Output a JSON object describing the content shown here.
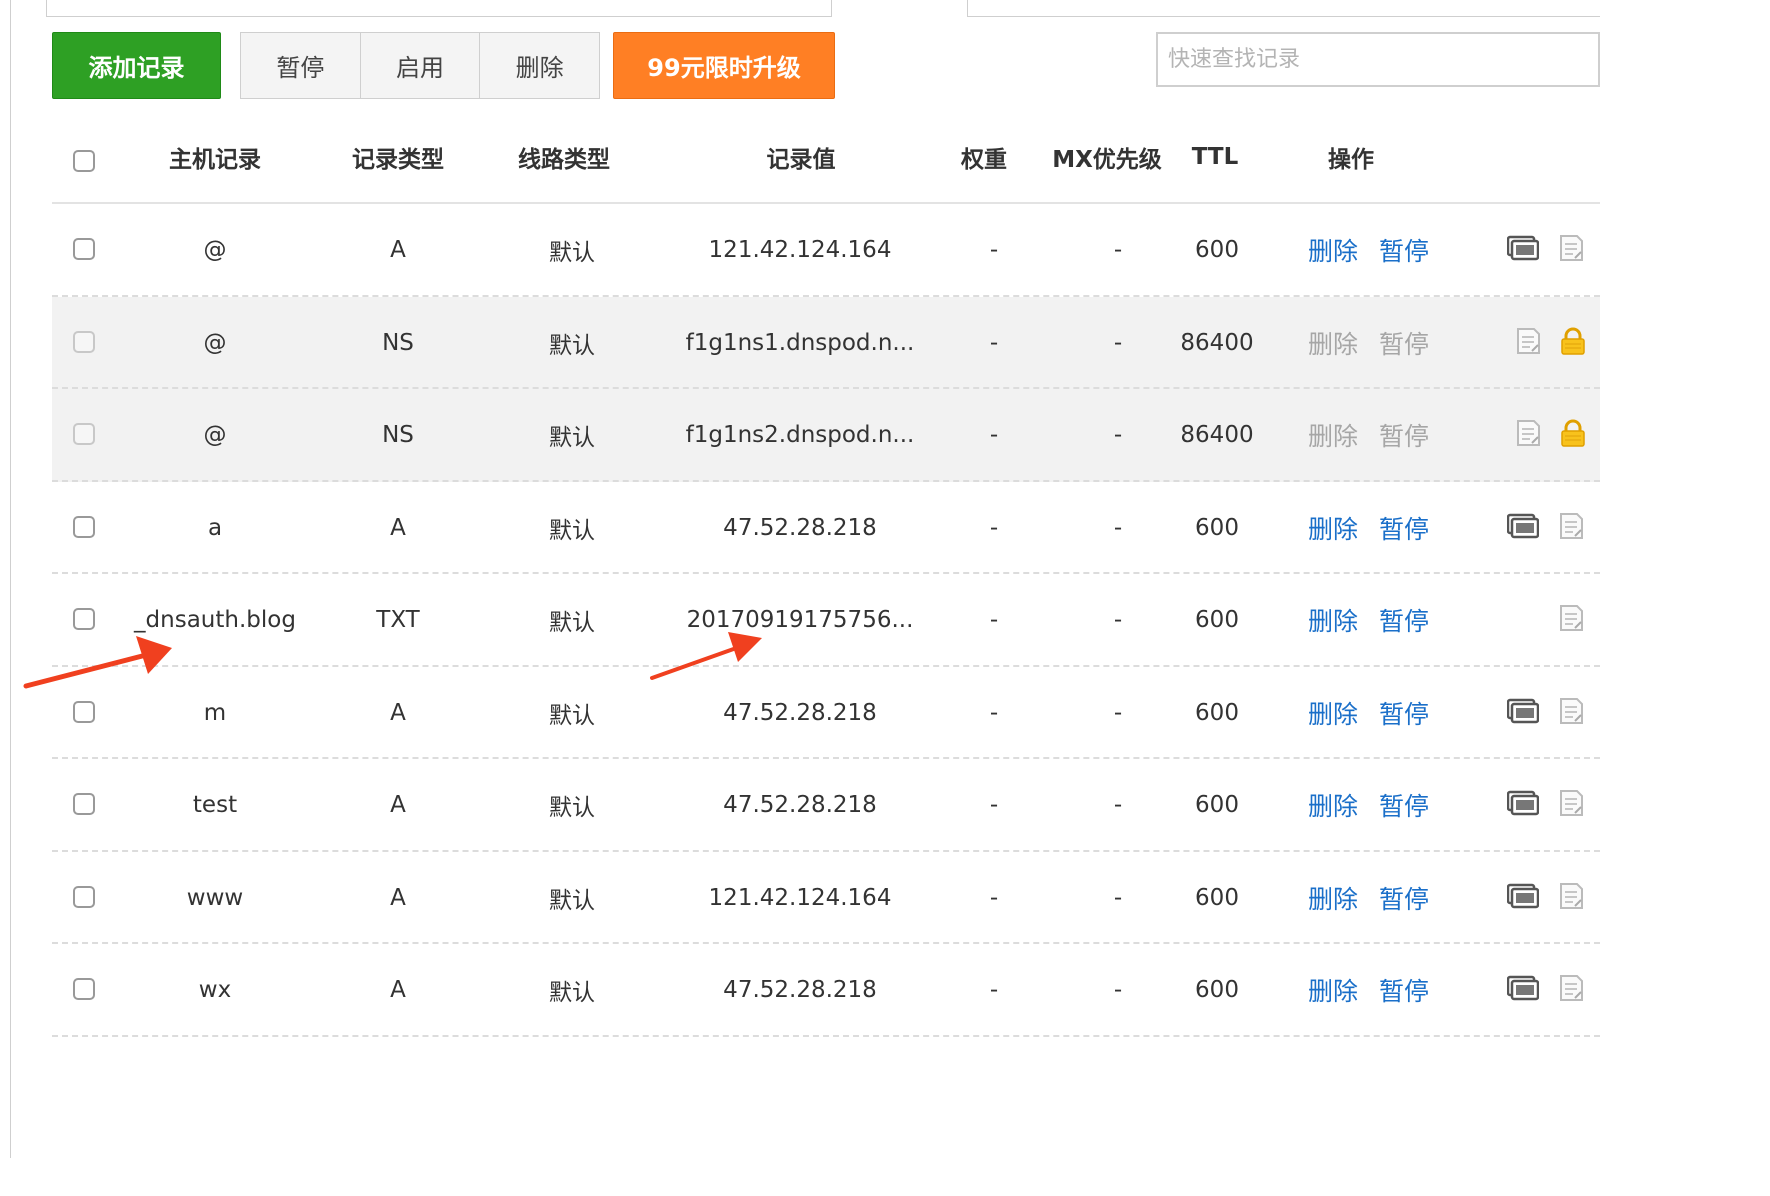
{
  "toolbar": {
    "add_label": "添加记录",
    "pause_label": "暂停",
    "enable_label": "启用",
    "delete_label": "删除",
    "upgrade_label": "99元限时升级",
    "search_placeholder": "快速查找记录"
  },
  "columns": {
    "host": "主机记录",
    "type": "记录类型",
    "line": "线路类型",
    "value": "记录值",
    "weight": "权重",
    "mx": "MX优先级",
    "ttl": "TTL",
    "ops": "操作"
  },
  "rows": [
    {
      "host": "@",
      "type": "A",
      "line": "默认",
      "value": "121.42.124.164",
      "weight": "-",
      "mx": "-",
      "ttl": "600",
      "delete": "删除",
      "pause": "暂停",
      "locked": false,
      "monitor": true
    },
    {
      "host": "@",
      "type": "NS",
      "line": "默认",
      "value": "f1g1ns1.dnspod.n...",
      "weight": "-",
      "mx": "-",
      "ttl": "86400",
      "delete": "删除",
      "pause": "暂停",
      "locked": true,
      "monitor": false
    },
    {
      "host": "@",
      "type": "NS",
      "line": "默认",
      "value": "f1g1ns2.dnspod.n...",
      "weight": "-",
      "mx": "-",
      "ttl": "86400",
      "delete": "删除",
      "pause": "暂停",
      "locked": true,
      "monitor": false
    },
    {
      "host": "a",
      "type": "A",
      "line": "默认",
      "value": "47.52.28.218",
      "weight": "-",
      "mx": "-",
      "ttl": "600",
      "delete": "删除",
      "pause": "暂停",
      "locked": false,
      "monitor": true
    },
    {
      "host": "_dnsauth.blog",
      "type": "TXT",
      "line": "默认",
      "value": "20170919175756...",
      "weight": "-",
      "mx": "-",
      "ttl": "600",
      "delete": "删除",
      "pause": "暂停",
      "locked": false,
      "monitor": false
    },
    {
      "host": "m",
      "type": "A",
      "line": "默认",
      "value": "47.52.28.218",
      "weight": "-",
      "mx": "-",
      "ttl": "600",
      "delete": "删除",
      "pause": "暂停",
      "locked": false,
      "monitor": true
    },
    {
      "host": "test",
      "type": "A",
      "line": "默认",
      "value": "47.52.28.218",
      "weight": "-",
      "mx": "-",
      "ttl": "600",
      "delete": "删除",
      "pause": "暂停",
      "locked": false,
      "monitor": true
    },
    {
      "host": "www",
      "type": "A",
      "line": "默认",
      "value": "121.42.124.164",
      "weight": "-",
      "mx": "-",
      "ttl": "600",
      "delete": "删除",
      "pause": "暂停",
      "locked": false,
      "monitor": true
    },
    {
      "host": "wx",
      "type": "A",
      "line": "默认",
      "value": "47.52.28.218",
      "weight": "-",
      "mx": "-",
      "ttl": "600",
      "delete": "删除",
      "pause": "暂停",
      "locked": false,
      "monitor": true
    }
  ],
  "colors": {
    "add_button": "#2ea024",
    "upgrade_button": "#ff7f24",
    "action_link": "#1a6fc9",
    "annotation_arrow": "#f0401f"
  }
}
